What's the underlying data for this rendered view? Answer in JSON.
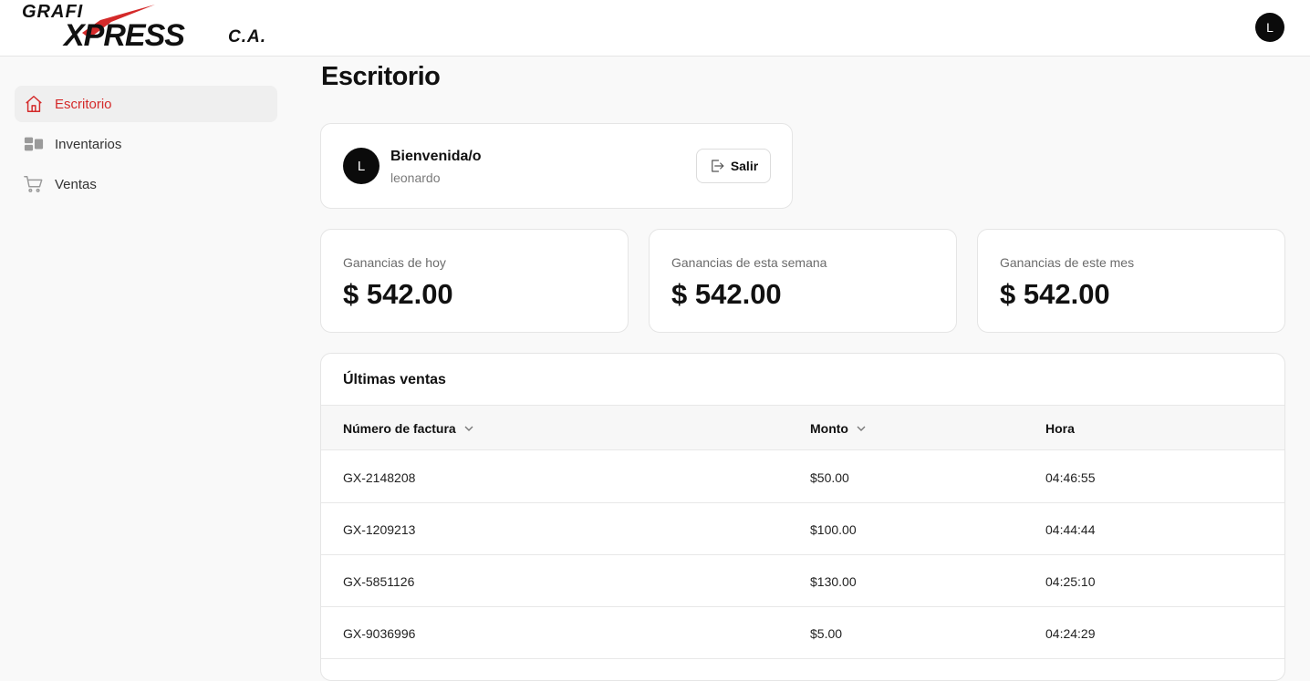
{
  "brand": {
    "logo_top": "GRAFI",
    "logo_main": "XPRESS",
    "logo_suffix": "C.A."
  },
  "header": {
    "avatar_initial": "L"
  },
  "sidebar": {
    "items": [
      {
        "label": "Escritorio",
        "icon": "home-icon",
        "active": true
      },
      {
        "label": "Inventarios",
        "icon": "inventory-icon",
        "active": false
      },
      {
        "label": "Ventas",
        "icon": "cart-icon",
        "active": false
      }
    ]
  },
  "page": {
    "title": "Escritorio"
  },
  "welcome": {
    "avatar_initial": "L",
    "greeting": "Bienvenida/o",
    "username": "leonardo",
    "logout_label": "Salir"
  },
  "stats": [
    {
      "label": "Ganancias de hoy",
      "value": "$ 542.00"
    },
    {
      "label": "Ganancias de esta semana",
      "value": "$ 542.00"
    },
    {
      "label": "Ganancias de este mes",
      "value": "$ 542.00"
    }
  ],
  "sales": {
    "title": "Últimas ventas",
    "columns": [
      "Número de factura",
      "Monto",
      "Hora"
    ],
    "rows": [
      [
        "GX-2148208",
        "$50.00",
        "04:46:55"
      ],
      [
        "GX-1209213",
        "$100.00",
        "04:44:44"
      ],
      [
        "GX-5851126",
        "$130.00",
        "04:25:10"
      ],
      [
        "GX-9036996",
        "$5.00",
        "04:24:29"
      ]
    ]
  },
  "colors": {
    "accent": "#d42a2a",
    "background": "#f9f9f9",
    "card": "#ffffff"
  }
}
